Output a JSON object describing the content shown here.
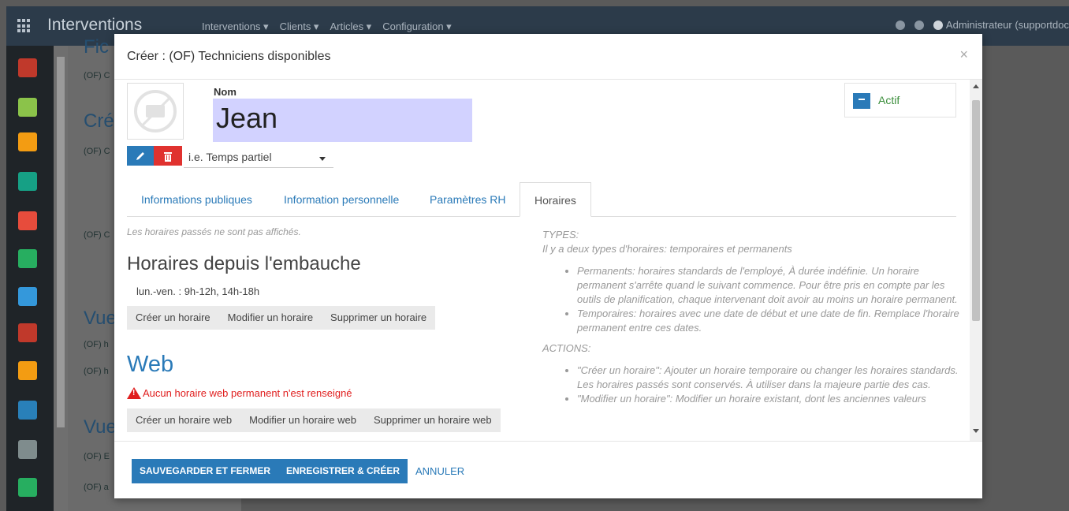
{
  "app": {
    "title": "Interventions",
    "menu": [
      "Interventions ▾",
      "Clients ▾",
      "Articles ▾",
      "Configuration ▾"
    ],
    "user": "Administrateur (supportdoc"
  },
  "background": {
    "fragments": [
      "(OF) C",
      "(OF) C",
      "(OF) C",
      "(OF) h",
      "(OF) h",
      "(OF) E",
      "(OF) a"
    ],
    "headings": [
      "Fic",
      "Cré",
      "Vue",
      "Vue"
    ]
  },
  "sidebar_icons": [
    {
      "name": "chat-icon",
      "color": "#c0392b"
    },
    {
      "name": "calendar-icon",
      "color": "#8bc34a"
    },
    {
      "name": "location-icon",
      "color": "#f39c12"
    },
    {
      "name": "contacts-icon",
      "color": "#16a085"
    },
    {
      "name": "folder-icon",
      "color": "#e74c3c"
    },
    {
      "name": "chart-icon",
      "color": "#27ae60"
    },
    {
      "name": "card-icon",
      "color": "#3498db"
    },
    {
      "name": "sitemap-icon",
      "color": "#c0392b"
    },
    {
      "name": "document-icon",
      "color": "#f39c12"
    },
    {
      "name": "hierarchy-icon",
      "color": "#2980b9"
    },
    {
      "name": "send-icon",
      "color": "#7f8c8d"
    },
    {
      "name": "tag-icon",
      "color": "#27ae60"
    }
  ],
  "modal": {
    "title": "Créer : (OF) Techniciens disponibles",
    "close": "×",
    "name_label": "Nom",
    "name_value": "Jean",
    "contract_placeholder": "i.e. Temps partiel",
    "status_label": "Actif",
    "tabs": [
      "Informations publiques",
      "Information personnelle",
      "Paramètres RH",
      "Horaires"
    ],
    "active_tab": "Horaires",
    "note": "Les horaires passés ne sont pas affichés.",
    "schedule_heading": "Horaires depuis l'embauche",
    "schedule_line": "lun.-ven. : 9h-12h, 14h-18h",
    "schedule_buttons": [
      "Créer un horaire",
      "Modifier un horaire",
      "Supprimer un horaire"
    ],
    "web_heading": "Web",
    "web_warning": "Aucun horaire web permanent n'est renseigné",
    "web_buttons": [
      "Créer un horaire web",
      "Modifier un horaire web",
      "Supprimer un horaire web"
    ],
    "help": {
      "types_title": "TYPES:",
      "types_intro": "Il y a deux types d'horaires: temporaires et permanents",
      "types_items": [
        "Permanents: horaires standards de l'employé, À durée indéfinie. Un horaire permanent s'arrête quand le suivant commence. Pour être pris en compte par les outils de planification, chaque intervenant doit avoir au moins un horaire permanent.",
        "Temporaires: horaires avec une date de début et une date de fin. Remplace l'horaire permanent entre ces dates."
      ],
      "actions_title": "ACTIONS:",
      "actions_items": [
        "\"Créer un horaire\": Ajouter un horaire temporaire ou changer les horaires standards. Les horaires passés sont conservés. À utiliser dans la majeure partie des cas.",
        "\"Modifier un horaire\": Modifier un horaire existant, dont les anciennes valeurs"
      ]
    },
    "footer": {
      "save_close": "SAUVEGARDER ET FERMER",
      "save_create": "ENREGISTRER & CRÉER",
      "cancel": "ANNULER"
    }
  }
}
